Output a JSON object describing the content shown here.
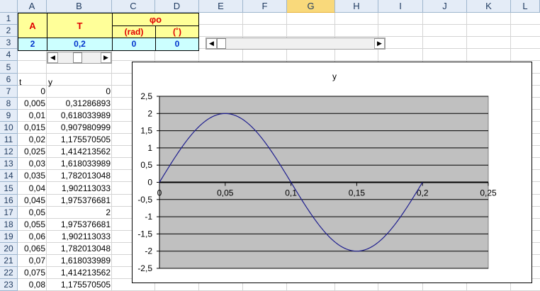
{
  "columns": [
    "A",
    "B",
    "C",
    "D",
    "E",
    "F",
    "G",
    "H",
    "I",
    "J",
    "K",
    "L"
  ],
  "rows": [
    "1",
    "2",
    "3",
    "4",
    "5",
    "6",
    "7",
    "8",
    "9",
    "10",
    "11",
    "12",
    "13",
    "14",
    "15",
    "16",
    "17",
    "18",
    "19",
    "20",
    "21",
    "22",
    "23"
  ],
  "header_block": {
    "A_label": "A",
    "T_label": "T",
    "phi_label": "φo",
    "rad_label": "(rad)",
    "deg_label": "(˚)"
  },
  "values_row": {
    "A": "2",
    "T": "0,2",
    "phi_rad": "0",
    "phi_deg": "0"
  },
  "table": {
    "col_t": "t",
    "col_y": "y",
    "rows": [
      {
        "t": "0",
        "y": "0"
      },
      {
        "t": "0,005",
        "y": "0,31286893"
      },
      {
        "t": "0,01",
        "y": "0,618033989"
      },
      {
        "t": "0,015",
        "y": "0,907980999"
      },
      {
        "t": "0,02",
        "y": "1,175570505"
      },
      {
        "t": "0,025",
        "y": "1,414213562"
      },
      {
        "t": "0,03",
        "y": "1,618033989"
      },
      {
        "t": "0,035",
        "y": "1,782013048"
      },
      {
        "t": "0,04",
        "y": "1,902113033"
      },
      {
        "t": "0,045",
        "y": "1,975376681"
      },
      {
        "t": "0,05",
        "y": "2"
      },
      {
        "t": "0,055",
        "y": "1,975376681"
      },
      {
        "t": "0,06",
        "y": "1,902113033"
      },
      {
        "t": "0,065",
        "y": "1,782013048"
      },
      {
        "t": "0,07",
        "y": "1,618033989"
      },
      {
        "t": "0,075",
        "y": "1,414213562"
      },
      {
        "t": "0,08",
        "y": "1,175570505"
      }
    ]
  },
  "chart_data": {
    "type": "line",
    "title": "y",
    "xlabel": "",
    "ylabel": "",
    "xlim": [
      0,
      0.25
    ],
    "ylim": [
      -2.5,
      2.5
    ],
    "x_ticks": [
      "0",
      "0,05",
      "0,1",
      "0,15",
      "0,2",
      "0,25"
    ],
    "y_ticks": [
      "2,5",
      "2",
      "1,5",
      "1",
      "0,5",
      "0",
      "-0,5",
      "-1",
      "-1,5",
      "-2",
      "-2,5"
    ],
    "grid": true,
    "series": [
      {
        "name": "",
        "color": "#1f1f8f",
        "amplitude": 2,
        "period": 0.2,
        "x_range": [
          0,
          0.2
        ]
      }
    ]
  }
}
